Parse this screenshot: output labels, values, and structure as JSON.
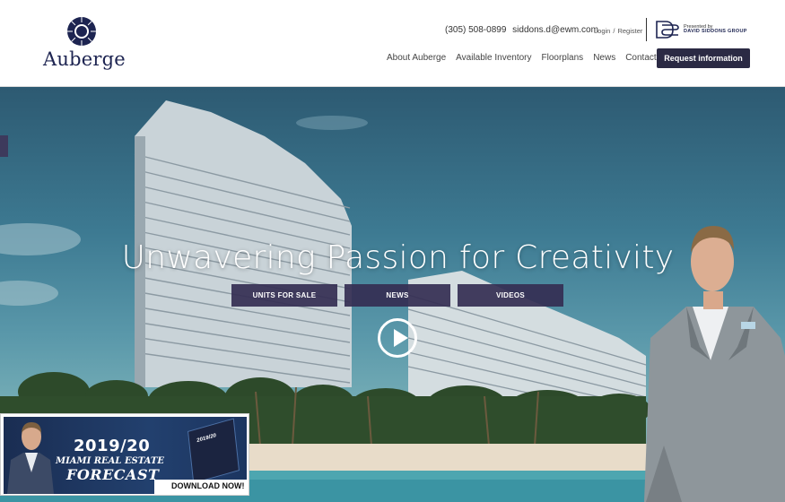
{
  "logo": {
    "name": "Auberge",
    "icon": "sunburst-face-icon"
  },
  "header": {
    "phone": "(305) 508-0899",
    "email": "siddons.d@ewm.com",
    "login": "Login",
    "login_sep": "/",
    "register": "Register",
    "presented_by": "Presented by",
    "group_name": "DAVID SIDDONS GROUP"
  },
  "nav": {
    "items": [
      "About Auberge",
      "Available Inventory",
      "Floorplans",
      "News",
      "Contact Us"
    ],
    "cta": "Request information"
  },
  "hero": {
    "headline": "Unwavering Passion for Creativity",
    "buttons": [
      "UNITS FOR SALE",
      "NEWS",
      "VIDEOS"
    ]
  },
  "banner": {
    "year": "2019/20",
    "line2": "MIAMI REAL ESTATE",
    "line3": "FORECAST",
    "book_title": "2019/20",
    "cta": "DOWNLOAD NOW!"
  },
  "colors": {
    "brand_navy": "#1d2451",
    "button_purple": "#2b2a44",
    "hero_button": "#342e52"
  }
}
